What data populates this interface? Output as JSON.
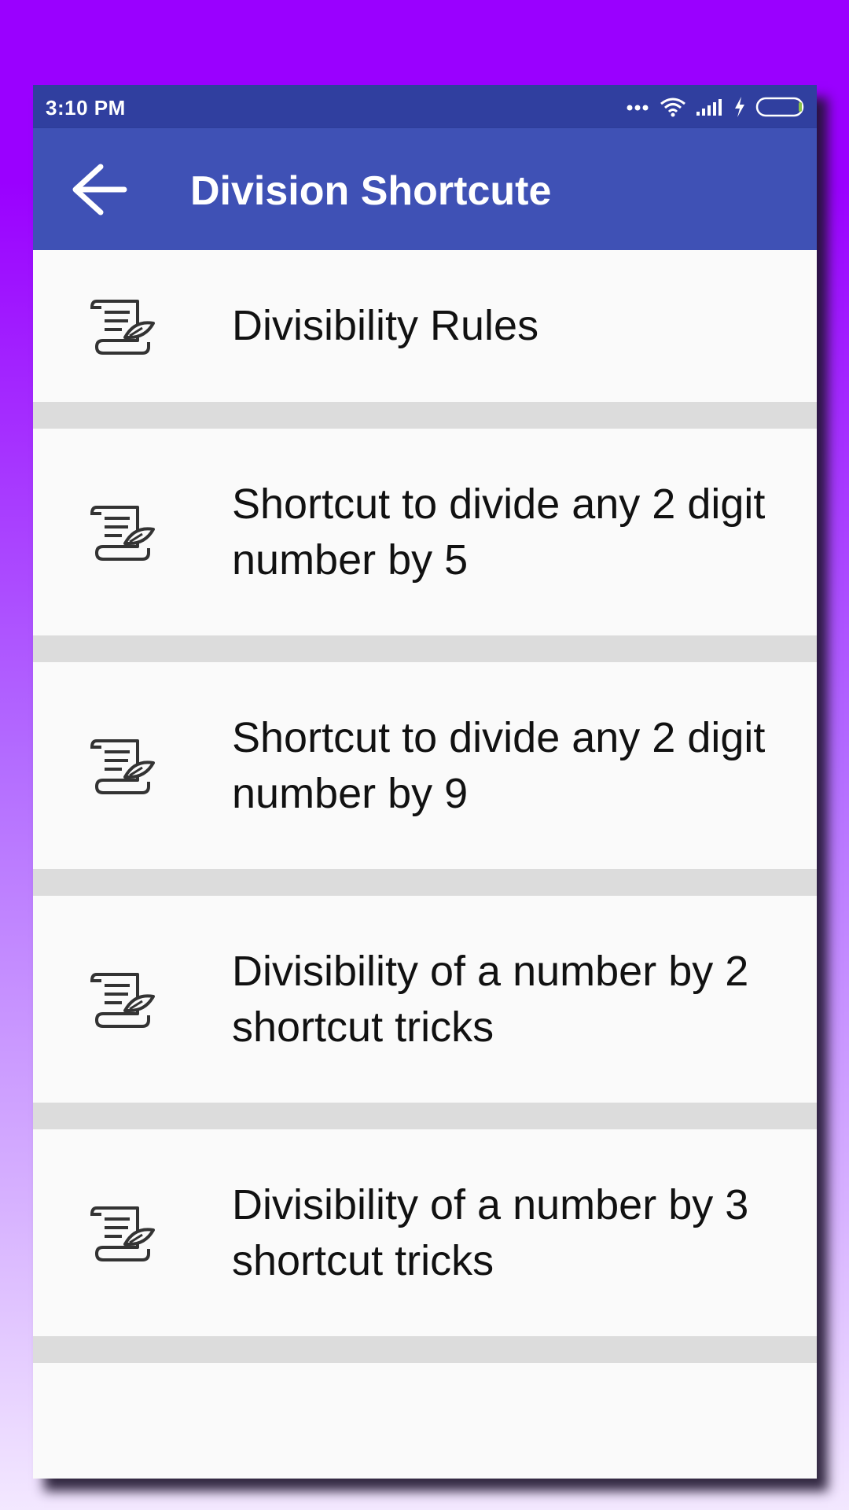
{
  "status_bar": {
    "time": "3:10 PM",
    "icons": [
      "more-dots-icon",
      "wifi-icon",
      "signal-icon",
      "charging-icon",
      "battery-icon"
    ]
  },
  "app_bar": {
    "back_icon": "arrow-back-icon",
    "title": "Division Shortcute"
  },
  "list": {
    "items": [
      {
        "icon": "scroll-document-icon",
        "label": "Divisibility Rules"
      },
      {
        "icon": "scroll-document-icon",
        "label": "Shortcut to divide any 2 digit number by 5"
      },
      {
        "icon": "scroll-document-icon",
        "label": "Shortcut to divide any 2 digit number by 9"
      },
      {
        "icon": "scroll-document-icon",
        "label": "Divisibility of a number by 2 shortcut tricks"
      },
      {
        "icon": "scroll-document-icon",
        "label": "Divisibility of a number by 3 shortcut tricks"
      }
    ]
  },
  "colors": {
    "status_bar": "#303f9f",
    "app_bar": "#3f51b5",
    "background_top": "#9a00ff",
    "list_background": "#fafafa",
    "separator": "#dcdcdc"
  }
}
